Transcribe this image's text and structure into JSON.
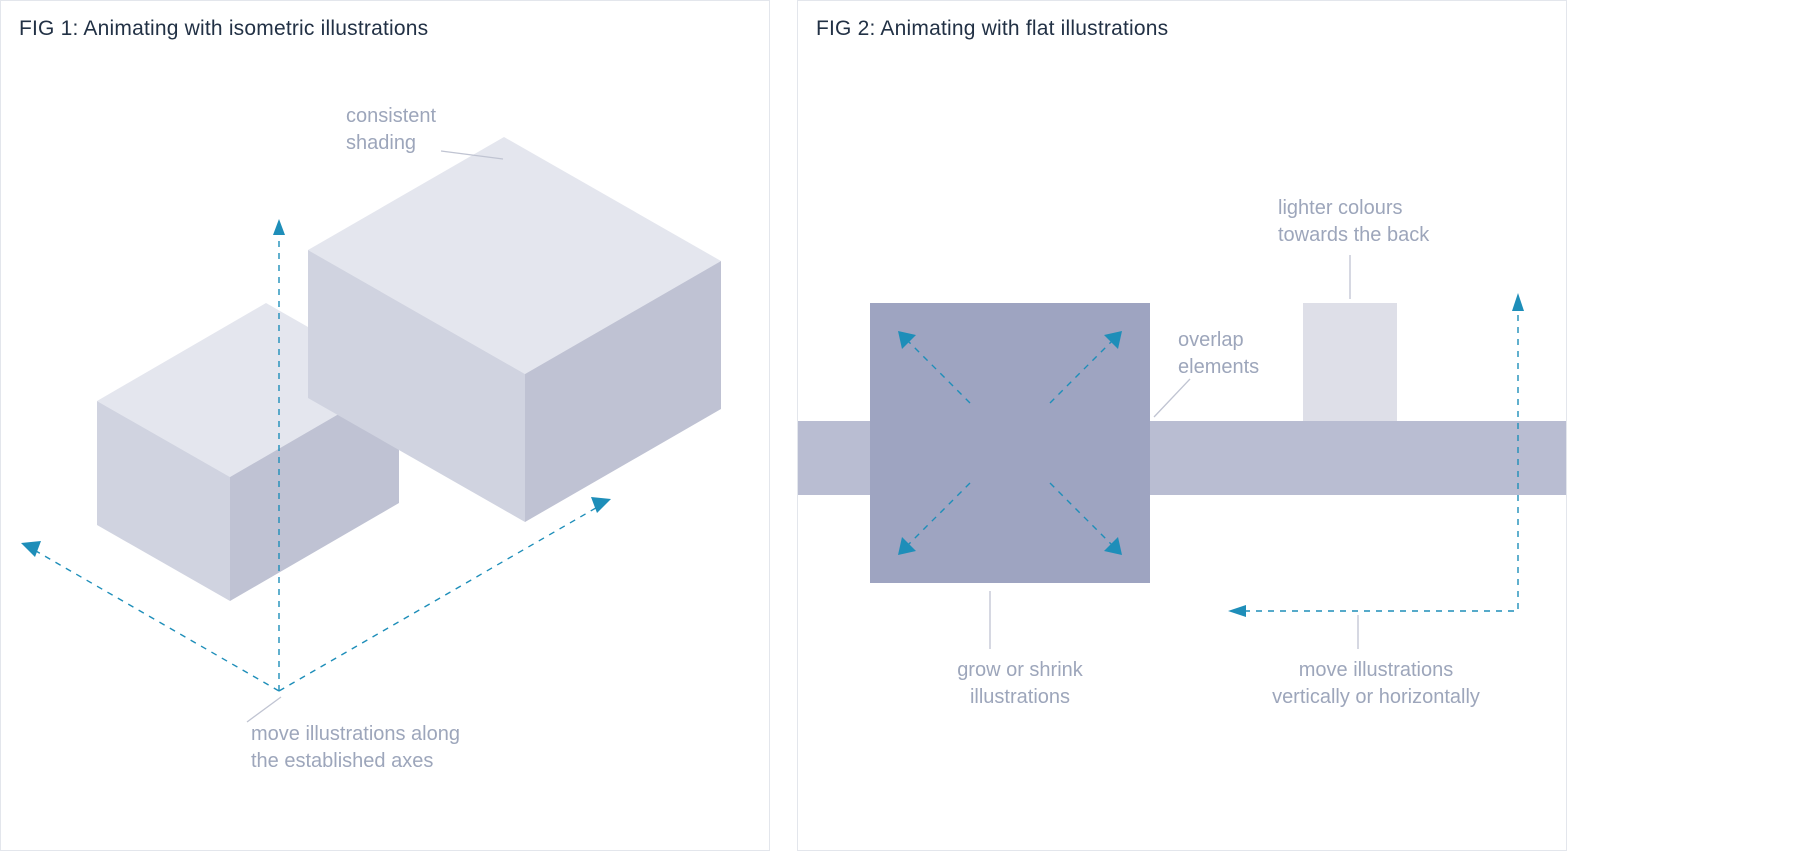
{
  "fig1": {
    "title": "FIG 1: Animating with isometric illustrations",
    "annot_shading_l1": "consistent",
    "annot_shading_l2": "shading",
    "annot_axes_l1": "move illustrations along",
    "annot_axes_l2": "the established axes"
  },
  "fig2": {
    "title": "FIG 2: Animating with flat illustrations",
    "annot_lighter_l1": "lighter colours",
    "annot_lighter_l2": "towards the back",
    "annot_overlap_l1": "overlap",
    "annot_overlap_l2": "elements",
    "annot_grow_l1": "grow or shrink",
    "annot_grow_l2": "illustrations",
    "annot_move_l1": "move illustrations",
    "annot_move_l2": "vertically or horizontally"
  },
  "colors": {
    "border": "#e3e6ec",
    "heading": "#223145",
    "annot": "#9da6bb",
    "arrow": "#1e8eb9",
    "iso_top": "#e4e6ee",
    "iso_left": "#d0d3e0",
    "iso_right": "#bfc2d3",
    "flat_square": "#9ea4c1",
    "flat_bar": "#b9bdd2",
    "flat_back": "#dedfe8",
    "leader": "#c0c4d2"
  }
}
